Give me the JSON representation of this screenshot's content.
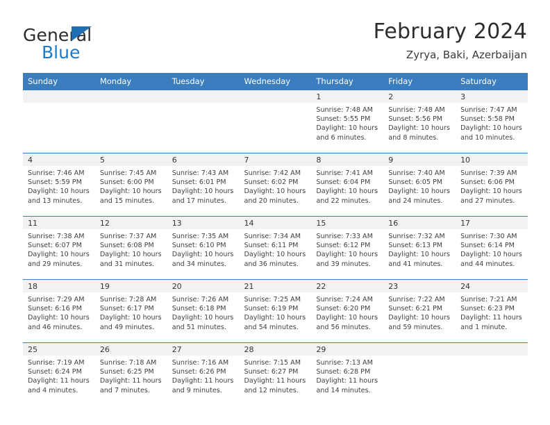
{
  "brand": {
    "logo_word_one": "General",
    "logo_word_two": "Blue",
    "accent_color": "#1f7ac4",
    "header_color": "#3a7ebf"
  },
  "header": {
    "title": "February 2024",
    "subtitle": "Zyrya, Baki, Azerbaijan"
  },
  "calendar": {
    "weekday_headers": [
      "Sunday",
      "Monday",
      "Tuesday",
      "Wednesday",
      "Thursday",
      "Friday",
      "Saturday"
    ],
    "weeks": [
      [
        {
          "day": "",
          "details": ""
        },
        {
          "day": "",
          "details": ""
        },
        {
          "day": "",
          "details": ""
        },
        {
          "day": "",
          "details": ""
        },
        {
          "day": "1",
          "details": "Sunrise: 7:48 AM\nSunset: 5:55 PM\nDaylight: 10 hours\nand 6 minutes."
        },
        {
          "day": "2",
          "details": "Sunrise: 7:48 AM\nSunset: 5:56 PM\nDaylight: 10 hours\nand 8 minutes."
        },
        {
          "day": "3",
          "details": "Sunrise: 7:47 AM\nSunset: 5:58 PM\nDaylight: 10 hours\nand 10 minutes."
        }
      ],
      [
        {
          "day": "4",
          "details": "Sunrise: 7:46 AM\nSunset: 5:59 PM\nDaylight: 10 hours\nand 13 minutes."
        },
        {
          "day": "5",
          "details": "Sunrise: 7:45 AM\nSunset: 6:00 PM\nDaylight: 10 hours\nand 15 minutes."
        },
        {
          "day": "6",
          "details": "Sunrise: 7:43 AM\nSunset: 6:01 PM\nDaylight: 10 hours\nand 17 minutes."
        },
        {
          "day": "7",
          "details": "Sunrise: 7:42 AM\nSunset: 6:02 PM\nDaylight: 10 hours\nand 20 minutes."
        },
        {
          "day": "8",
          "details": "Sunrise: 7:41 AM\nSunset: 6:04 PM\nDaylight: 10 hours\nand 22 minutes."
        },
        {
          "day": "9",
          "details": "Sunrise: 7:40 AM\nSunset: 6:05 PM\nDaylight: 10 hours\nand 24 minutes."
        },
        {
          "day": "10",
          "details": "Sunrise: 7:39 AM\nSunset: 6:06 PM\nDaylight: 10 hours\nand 27 minutes."
        }
      ],
      [
        {
          "day": "11",
          "details": "Sunrise: 7:38 AM\nSunset: 6:07 PM\nDaylight: 10 hours\nand 29 minutes."
        },
        {
          "day": "12",
          "details": "Sunrise: 7:37 AM\nSunset: 6:08 PM\nDaylight: 10 hours\nand 31 minutes."
        },
        {
          "day": "13",
          "details": "Sunrise: 7:35 AM\nSunset: 6:10 PM\nDaylight: 10 hours\nand 34 minutes."
        },
        {
          "day": "14",
          "details": "Sunrise: 7:34 AM\nSunset: 6:11 PM\nDaylight: 10 hours\nand 36 minutes."
        },
        {
          "day": "15",
          "details": "Sunrise: 7:33 AM\nSunset: 6:12 PM\nDaylight: 10 hours\nand 39 minutes."
        },
        {
          "day": "16",
          "details": "Sunrise: 7:32 AM\nSunset: 6:13 PM\nDaylight: 10 hours\nand 41 minutes."
        },
        {
          "day": "17",
          "details": "Sunrise: 7:30 AM\nSunset: 6:14 PM\nDaylight: 10 hours\nand 44 minutes."
        }
      ],
      [
        {
          "day": "18",
          "details": "Sunrise: 7:29 AM\nSunset: 6:16 PM\nDaylight: 10 hours\nand 46 minutes."
        },
        {
          "day": "19",
          "details": "Sunrise: 7:28 AM\nSunset: 6:17 PM\nDaylight: 10 hours\nand 49 minutes."
        },
        {
          "day": "20",
          "details": "Sunrise: 7:26 AM\nSunset: 6:18 PM\nDaylight: 10 hours\nand 51 minutes."
        },
        {
          "day": "21",
          "details": "Sunrise: 7:25 AM\nSunset: 6:19 PM\nDaylight: 10 hours\nand 54 minutes."
        },
        {
          "day": "22",
          "details": "Sunrise: 7:24 AM\nSunset: 6:20 PM\nDaylight: 10 hours\nand 56 minutes."
        },
        {
          "day": "23",
          "details": "Sunrise: 7:22 AM\nSunset: 6:21 PM\nDaylight: 10 hours\nand 59 minutes."
        },
        {
          "day": "24",
          "details": "Sunrise: 7:21 AM\nSunset: 6:23 PM\nDaylight: 11 hours\nand 1 minute."
        }
      ],
      [
        {
          "day": "25",
          "details": "Sunrise: 7:19 AM\nSunset: 6:24 PM\nDaylight: 11 hours\nand 4 minutes."
        },
        {
          "day": "26",
          "details": "Sunrise: 7:18 AM\nSunset: 6:25 PM\nDaylight: 11 hours\nand 7 minutes."
        },
        {
          "day": "27",
          "details": "Sunrise: 7:16 AM\nSunset: 6:26 PM\nDaylight: 11 hours\nand 9 minutes."
        },
        {
          "day": "28",
          "details": "Sunrise: 7:15 AM\nSunset: 6:27 PM\nDaylight: 11 hours\nand 12 minutes."
        },
        {
          "day": "29",
          "details": "Sunrise: 7:13 AM\nSunset: 6:28 PM\nDaylight: 11 hours\nand 14 minutes."
        },
        {
          "day": "",
          "details": ""
        },
        {
          "day": "",
          "details": ""
        }
      ]
    ]
  }
}
